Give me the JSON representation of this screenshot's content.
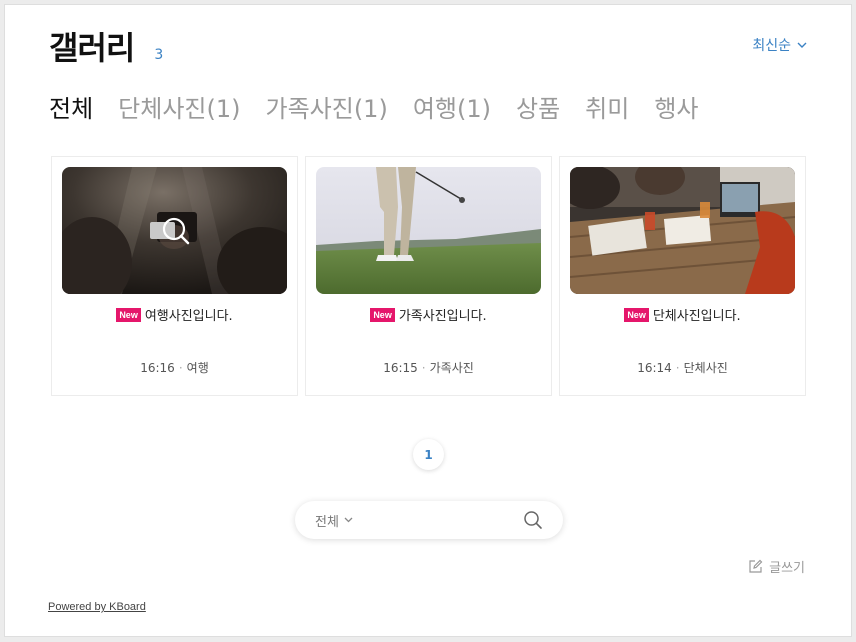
{
  "header": {
    "title": "갤러리",
    "count": "3"
  },
  "sort": {
    "label": "최신순"
  },
  "tabs": [
    {
      "label": "전체",
      "active": true
    },
    {
      "label": "단체사진(1)",
      "active": false
    },
    {
      "label": "가족사진(1)",
      "active": false
    },
    {
      "label": "여행(1)",
      "active": false
    },
    {
      "label": "상품",
      "active": false
    },
    {
      "label": "취미",
      "active": false
    },
    {
      "label": "행사",
      "active": false
    }
  ],
  "posts": [
    {
      "badge": "New",
      "title": "여행사진입니다.",
      "time": "16:16",
      "category": "여행",
      "thumbnail_icon": "camera-search-icon"
    },
    {
      "badge": "New",
      "title": "가족사진입니다.",
      "time": "16:15",
      "category": "가족사진"
    },
    {
      "badge": "New",
      "title": "단체사진입니다.",
      "time": "16:14",
      "category": "단체사진"
    }
  ],
  "pagination": {
    "current": "1"
  },
  "search": {
    "category": "전체",
    "value": ""
  },
  "write": {
    "label": "글쓰기"
  },
  "footer": {
    "powered": "Powered by KBoard"
  },
  "colors": {
    "accent": "#3b82c4",
    "badge": "#e5166b"
  }
}
